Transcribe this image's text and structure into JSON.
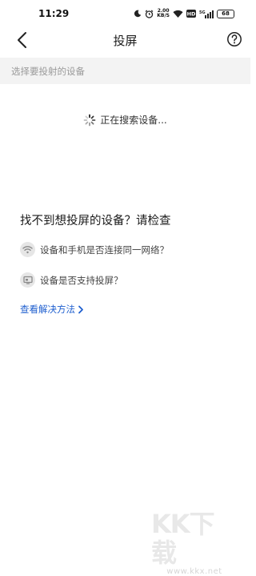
{
  "status_bar": {
    "time": "11:29",
    "net_speed_value": "2.00",
    "net_speed_unit": "KB/S",
    "hd_label": "HD",
    "signal_label": "5G",
    "battery_level": "68"
  },
  "header": {
    "title": "投屏"
  },
  "section": {
    "select_label": "选择要投射的设备"
  },
  "search": {
    "status_text": "正在搜索设备..."
  },
  "help": {
    "title": "找不到想投屏的设备？请检查",
    "tips": [
      {
        "icon": "wifi-icon",
        "text": "设备和手机是否连接同一网络？"
      },
      {
        "icon": "tv-icon",
        "text": "设备是否支持投屏？"
      }
    ],
    "link_label": "查看解决方法"
  },
  "watermark": {
    "logo": "KK下载",
    "domain": "www.kkx.net"
  },
  "colors": {
    "link": "#1f5fcf",
    "section_bg": "#f3f3f3",
    "section_text": "#9a9a9a"
  }
}
